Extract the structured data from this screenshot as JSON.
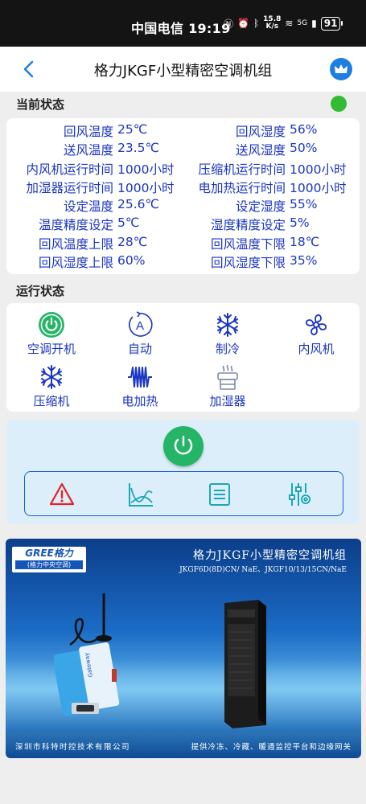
{
  "statusbar": {
    "carrier_time": "中国电信 19:19",
    "net_speed": "15.8\nK/s",
    "signal": "5G",
    "battery": "91"
  },
  "header": {
    "title": "格力JKGF小型精密空调机组"
  },
  "sections": {
    "current": "当前状态",
    "running": "运行状态"
  },
  "params": [
    {
      "l1": "回风温度",
      "v1": "25℃",
      "l2": "回风湿度",
      "v2": "56%"
    },
    {
      "l1": "送风温度",
      "v1": "23.5℃",
      "l2": "送风湿度",
      "v2": "50%"
    },
    {
      "l1": "内风机运行时间",
      "v1": "1000小时",
      "l2": "压缩机运行时间",
      "v2": "1000小时"
    },
    {
      "l1": "加湿器运行时间",
      "v1": "1000小时",
      "l2": "电加热运行时间",
      "v2": "1000小时"
    },
    {
      "l1": "设定温度",
      "v1": "25.6℃",
      "l2": "设定湿度",
      "v2": "55%"
    },
    {
      "l1": "温度精度设定",
      "v1": "5℃",
      "l2": "湿度精度设定",
      "v2": "5%"
    },
    {
      "l1": "回风温度上限",
      "v1": "28℃",
      "l2": "回风温度下限",
      "v2": "18℃"
    },
    {
      "l1": "回风湿度上限",
      "v1": "60%",
      "l2": "回风湿度下限",
      "v2": "35%"
    }
  ],
  "running": {
    "ac_power": "空调开机",
    "auto": "自动",
    "auto_glyph": "A",
    "cooling": "制冷",
    "indoor_fan": "内风机",
    "compressor": "压缩机",
    "heater": "电加热",
    "humidifier": "加湿器"
  },
  "colors": {
    "accent_blue": "#1a35c4",
    "status_green": "#33bb33",
    "power_green": "#25b567",
    "alert_red": "#e02424",
    "tool_teal": "#1aa7b8"
  },
  "icons": [
    "back-arrow-icon",
    "crown-icon",
    "power-icon",
    "auto-icon",
    "snowflake-icon",
    "fan-icon",
    "heater-icon",
    "humidifier-icon",
    "warning-icon",
    "chart-icon",
    "list-icon",
    "settings-sliders-icon"
  ],
  "banner": {
    "logo_top": "GREE格力",
    "logo_bottom": "(格力中央空调)",
    "title": "格力JKGF小型精密空调机组",
    "subtitle": "JKGF6D(8D)CN/ NaE、JKGF10/13/15CN/NaE",
    "device_label": "Gateway",
    "footer_left": "深圳市科特时控技术有限公司",
    "footer_right": "提供冷冻、冷藏、暖通监控平台和边缘网关"
  }
}
